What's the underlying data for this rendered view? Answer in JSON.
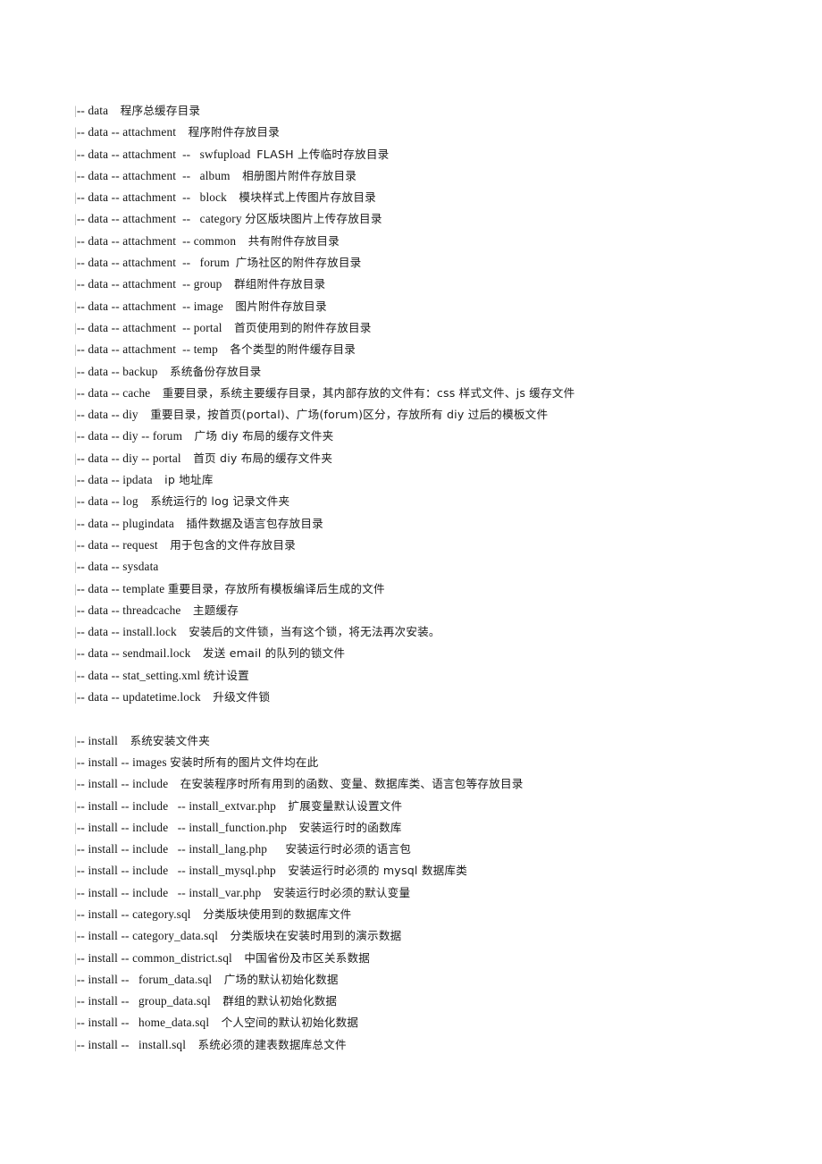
{
  "document": {
    "type": "plain-text-directory-tree",
    "bar_glyph": "|",
    "lines": [
      {
        "bar": "|",
        "path": "-- data",
        "gap": " ",
        "desc": "程序总缓存目录"
      },
      {
        "bar": "|",
        "path": "-- data -- attachment",
        "gap": " ",
        "desc": "程序附件存放目录"
      },
      {
        "bar": "|",
        "path": "-- data -- attachment  --   swfupload",
        "gap": " ",
        "desc": "FLASH 上传临时存放目录"
      },
      {
        "bar": "|",
        "path": "-- data -- attachment  --   album",
        "gap": " ",
        "desc": "相册图片附件存放目录"
      },
      {
        "bar": "|",
        "path": "-- data -- attachment  --   block",
        "gap": " ",
        "desc": "模块样式上传图片存放目录"
      },
      {
        "bar": "|",
        "path": "-- data -- attachment  --   category",
        "gap": " ",
        "desc": "分区版块图片上传存放目录"
      },
      {
        "bar": "|",
        "path": "-- data -- attachment  -- common",
        "gap": " ",
        "desc": "共有附件存放目录"
      },
      {
        "bar": "|",
        "path": "-- data -- attachment  --   forum",
        "gap": " ",
        "desc": "广场社区的附件存放目录"
      },
      {
        "bar": "|",
        "path": "-- data -- attachment  -- group",
        "gap": " ",
        "desc": "群组附件存放目录"
      },
      {
        "bar": "|",
        "path": "-- data -- attachment  -- image",
        "gap": " ",
        "desc": "图片附件存放目录"
      },
      {
        "bar": "|",
        "path": "-- data -- attachment  -- portal",
        "gap": " ",
        "desc": "首页使用到的附件存放目录"
      },
      {
        "bar": "|",
        "path": "-- data -- attachment  -- temp",
        "gap": " ",
        "desc": "各个类型的附件缓存目录"
      },
      {
        "bar": "|",
        "path": "-- data -- backup",
        "gap": " ",
        "desc": "系统备份存放目录"
      },
      {
        "bar": "|",
        "path": "-- data -- cache",
        "gap": " ",
        "desc": "重要目录，系统主要缓存目录，其内部存放的文件有：css 样式文件、js 缓存文件"
      },
      {
        "bar": "|",
        "path": "-- data -- diy",
        "gap": " ",
        "desc": "重要目录，按首页(portal)、广场(forum)区分，存放所有 diy 过后的模板文件"
      },
      {
        "bar": "|",
        "path": "-- data -- diy -- forum",
        "gap": " ",
        "desc": "广场 diy 布局的缓存文件夹"
      },
      {
        "bar": "|",
        "path": "-- data -- diy -- portal",
        "gap": " ",
        "desc": "首页 diy 布局的缓存文件夹"
      },
      {
        "bar": "|",
        "path": "-- data -- ipdata",
        "gap": " ",
        "desc": "ip 地址库"
      },
      {
        "bar": "|",
        "path": "-- data -- log",
        "gap": " ",
        "desc": "系统运行的 log 记录文件夹"
      },
      {
        "bar": "|",
        "path": "-- data -- plugindata",
        "gap": " ",
        "desc": "插件数据及语言包存放目录"
      },
      {
        "bar": "|",
        "path": "-- data -- request",
        "gap": " ",
        "desc": "用于包含的文件存放目录"
      },
      {
        "bar": "|",
        "path": "-- data -- sysdata",
        "gap": "",
        "desc": ""
      },
      {
        "bar": "|",
        "path": "-- data -- template",
        "gap": " ",
        "desc": "重要目录，存放所有模板编译后生成的文件"
      },
      {
        "bar": "|",
        "path": "-- data -- threadcache",
        "gap": " ",
        "desc": "主题缓存"
      },
      {
        "bar": "|",
        "path": "-- data -- install.lock",
        "gap": " ",
        "desc": "安装后的文件锁，当有这个锁，将无法再次安装。"
      },
      {
        "bar": "|",
        "path": "-- data -- sendmail.lock",
        "gap": " ",
        "desc": "发送 email 的队列的锁文件"
      },
      {
        "bar": "|",
        "path": "-- data -- stat_setting.xml",
        "gap": " ",
        "desc": "统计设置"
      },
      {
        "bar": "|",
        "path": "-- data -- updatetime.lock",
        "gap": " ",
        "desc": "升级文件锁"
      },
      {
        "blank": true
      },
      {
        "bar": "|",
        "path": "-- install",
        "gap": " ",
        "desc": "系统安装文件夹"
      },
      {
        "bar": "|",
        "path": "-- install -- images",
        "gap": " ",
        "desc": "安装时所有的图片文件均在此"
      },
      {
        "bar": "|",
        "path": "-- install -- include",
        "gap": " ",
        "desc": "在安装程序时所有用到的函数、变量、数据库类、语言包等存放目录"
      },
      {
        "bar": "|",
        "path": "-- install -- include   -- install_extvar.php",
        "gap": " ",
        "desc": "扩展变量默认设置文件"
      },
      {
        "bar": "|",
        "path": "-- install -- include   -- install_function.php",
        "gap": " ",
        "desc": "安装运行时的函数库"
      },
      {
        "bar": "|",
        "path": "-- install -- include   -- install_lang.php",
        "gap": "  ",
        "desc": "安装运行时必须的语言包"
      },
      {
        "bar": "|",
        "path": "-- install -- include   -- install_mysql.php",
        "gap": " ",
        "desc": "安装运行时必须的 mysql 数据库类"
      },
      {
        "bar": "|",
        "path": "-- install -- include   -- install_var.php",
        "gap": " ",
        "desc": "安装运行时必须的默认变量"
      },
      {
        "bar": "|",
        "path": "-- install -- category.sql",
        "gap": " ",
        "desc": "分类版块使用到的数据库文件"
      },
      {
        "bar": "|",
        "path": "-- install -- category_data.sql",
        "gap": " ",
        "desc": "分类版块在安装时用到的演示数据"
      },
      {
        "bar": "|",
        "path": "-- install -- common_district.sql",
        "gap": " ",
        "desc": "中国省份及市区关系数据"
      },
      {
        "bar": "|",
        "path": "-- install --   forum_data.sql",
        "gap": " ",
        "desc": "广场的默认初始化数据"
      },
      {
        "bar": "|",
        "path": "-- install --   group_data.sql",
        "gap": " ",
        "desc": "群组的默认初始化数据"
      },
      {
        "bar": "|",
        "path": "-- install --   home_data.sql",
        "gap": " ",
        "desc": "个人空间的默认初始化数据"
      },
      {
        "bar": "|",
        "path": "-- install --   install.sql",
        "gap": " ",
        "desc": "系统必须的建表数据库总文件"
      }
    ]
  }
}
